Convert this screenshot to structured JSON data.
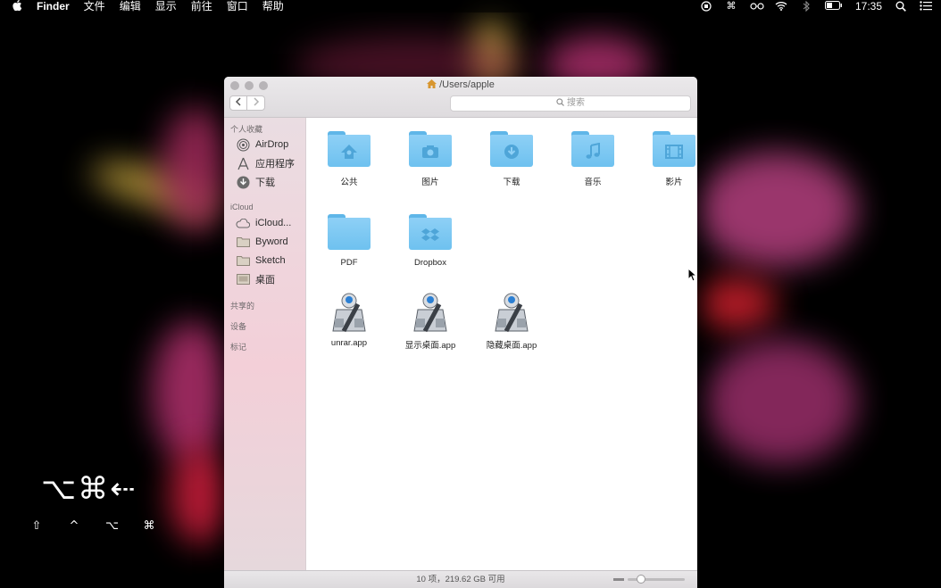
{
  "menubar": {
    "apple": "",
    "app_name": "Finder",
    "items": [
      "文件",
      "编辑",
      "显示",
      "前往",
      "窗口",
      "帮助"
    ],
    "clock": "17:35"
  },
  "window": {
    "title": "/Users/apple",
    "nav_back": "<",
    "nav_forward": ">",
    "search_placeholder": "搜索"
  },
  "sidebar": {
    "favorites_header": "个人收藏",
    "favorites": [
      {
        "label": "AirDrop",
        "icon": "airdrop-icon"
      },
      {
        "label": "应用程序",
        "icon": "applications-icon"
      },
      {
        "label": "下载",
        "icon": "download-icon"
      }
    ],
    "icloud_header": "iCloud",
    "icloud": [
      {
        "label": "iCloud...",
        "icon": "cloud-icon"
      },
      {
        "label": "Byword",
        "icon": "folder-icon"
      },
      {
        "label": "Sketch",
        "icon": "folder-icon"
      },
      {
        "label": "桌面",
        "icon": "desktop-folder-icon"
      }
    ],
    "shared_header": "共享的",
    "devices_header": "设备",
    "tags_header": "标记"
  },
  "files": [
    {
      "label": "公共",
      "icon": "public-folder-icon"
    },
    {
      "label": "图片",
      "icon": "pictures-folder-icon"
    },
    {
      "label": "下载",
      "icon": "downloads-folder-icon"
    },
    {
      "label": "音乐",
      "icon": "music-folder-icon"
    },
    {
      "label": "影片",
      "icon": "movies-folder-icon"
    },
    {
      "label": "PDF",
      "icon": "folder-icon"
    },
    {
      "label": "Dropbox",
      "icon": "dropbox-folder-icon"
    },
    {
      "label": "unrar.app",
      "icon": "automator-app-icon"
    },
    {
      "label": "显示桌面.app",
      "icon": "automator-app-icon"
    },
    {
      "label": "隐藏桌面.app",
      "icon": "automator-app-icon"
    }
  ],
  "statusbar": {
    "text": "10 项，219.62 GB 可用"
  },
  "keyboard_overlay": {
    "combo": "⌥⌘⇠",
    "modifiers": [
      "⇧",
      "^",
      "⌥",
      "⌘"
    ]
  }
}
